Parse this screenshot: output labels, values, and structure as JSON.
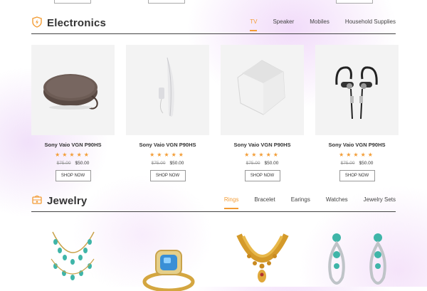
{
  "electronics": {
    "title": "Electronics",
    "icon": "shield-bolt-icon",
    "tabs": [
      "TV",
      "Speaker",
      "Mobiles",
      "Household Supplies"
    ],
    "active_tab": "TV",
    "products": [
      {
        "name": "Sony Vaio VGN P90HS",
        "rating": 5,
        "old_price": "$75.00",
        "price": "$50.00",
        "button": "SHOP NOW",
        "image": "bluetooth-speaker"
      },
      {
        "name": "Sony Vaio VGN P90HS",
        "rating": 5,
        "old_price": "$75.00",
        "price": "$50.00",
        "button": "SHOP NOW",
        "image": "wall-speaker"
      },
      {
        "name": "Sony Vaio VGN P90HS",
        "rating": 5,
        "old_price": "$75.00",
        "price": "$50.00",
        "button": "SHOP NOW",
        "image": "white-speaker"
      },
      {
        "name": "Sony Vaio VGN P90HS",
        "rating": 5,
        "old_price": "$75.00",
        "price": "$50.00",
        "button": "SHOP NOW",
        "image": "earphones"
      }
    ]
  },
  "jewelry": {
    "title": "Jewelry",
    "icon": "jewelry-icon",
    "tabs": [
      "Rings",
      "Bracelet",
      "Earings",
      "Watches",
      "Jewelry Sets"
    ],
    "active_tab": "Rings",
    "products": [
      {
        "image": "turquoise-necklace"
      },
      {
        "image": "blue-topaz-ring"
      },
      {
        "image": "gold-necklace"
      },
      {
        "image": "turquoise-earrings"
      }
    ]
  },
  "colors": {
    "accent": "#f39c34",
    "text": "#333333",
    "rule": "#444444"
  }
}
